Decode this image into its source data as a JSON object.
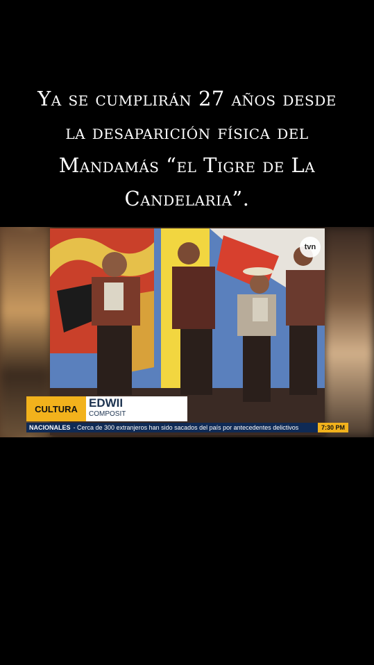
{
  "caption": {
    "line1": "Ya se cumplirán 27 años desde",
    "line2": "la desaparición física del",
    "line3": "Mandamás “el Tigre de La",
    "line4": "Candelaria”."
  },
  "video": {
    "channel_logo": "tvn",
    "lower_third": {
      "section": "CULTURA",
      "name": "EDWII",
      "role": "COMPOSIT"
    },
    "ticker": {
      "section": "NACIONALES",
      "headline": "- Cerca de 300 extranjeros han sido sacados del país por antecedentes delictivos",
      "time": "7:30 PM"
    }
  }
}
